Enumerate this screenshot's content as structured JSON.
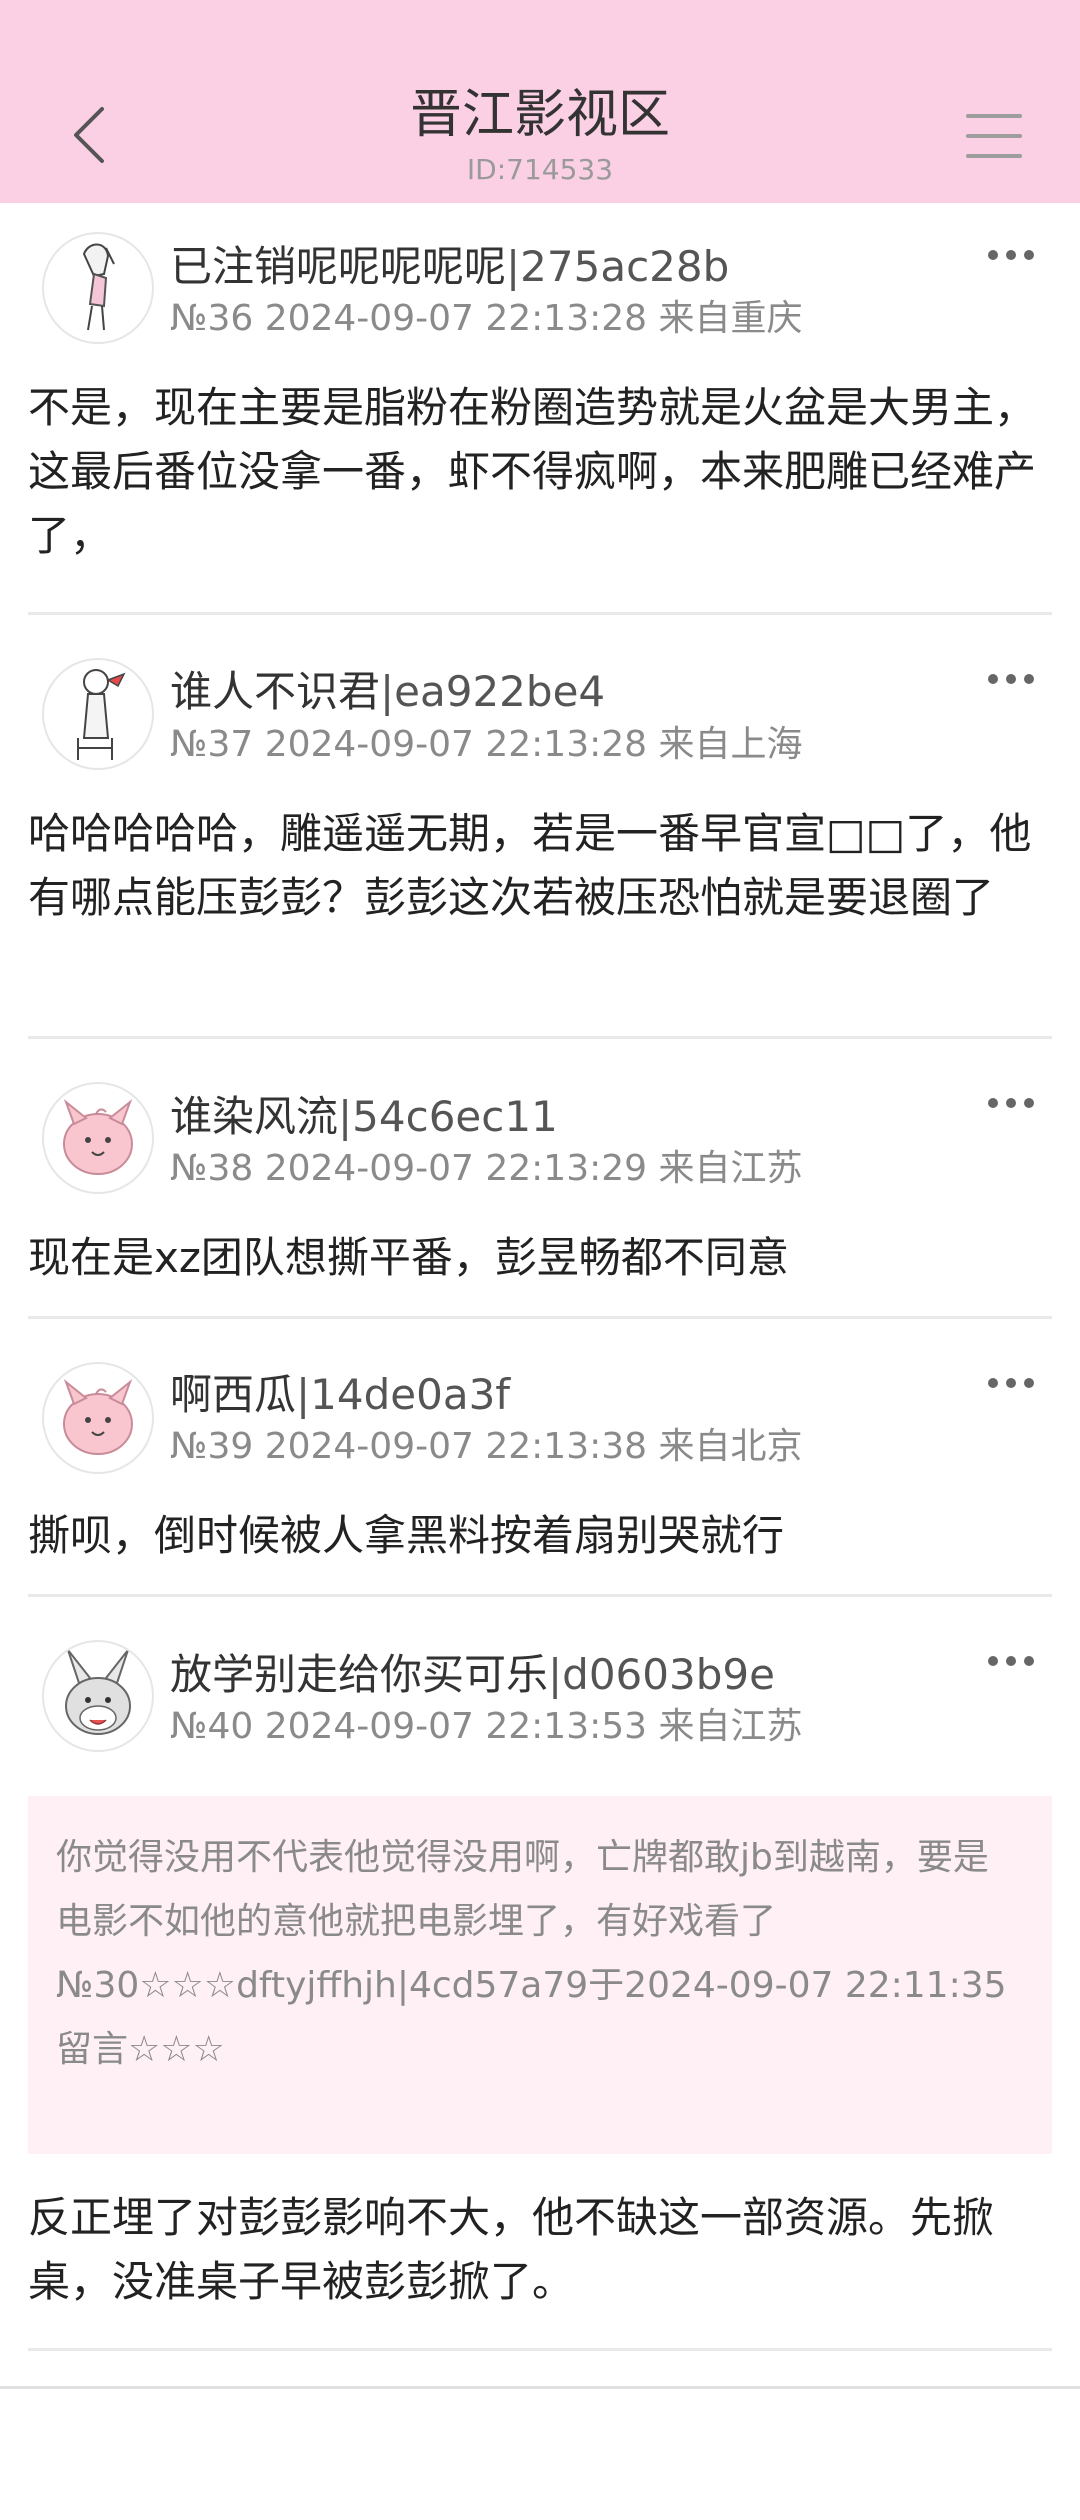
{
  "header": {
    "title": "晋江影视区",
    "subtitle": "ID:714533",
    "bg_color": "#fbd0e4"
  },
  "posts": [
    {
      "author": "已注销呢呢呢呢呢",
      "uid": "|275ac28b",
      "meta": "№36 2024-09-07 22:13:28 来自重庆",
      "content": "不是，现在主要是脂粉在粉圈造势就是火盆是大男主，这最后番位没拿一番，虾不得疯啊，本来肥雕已经难产了，",
      "avatar_icon": "anime-girl-avatar-icon"
    },
    {
      "author": "谁人不识君",
      "uid": "|ea922be4",
      "meta": "№37 2024-09-07 22:13:28 来自上海",
      "content": "哈哈哈哈哈，雕遥遥无期，若是一番早官宣□□了，他有哪点能压彭彭？彭彭这次若被压恐怕就是要退圈了",
      "avatar_icon": "sketch-girl-avatar-icon"
    },
    {
      "author": "谁染风流",
      "uid": "|54c6ec11",
      "meta": "№38 2024-09-07 22:13:29 来自江苏",
      "content": "现在是xz团队想撕平番，彭昱畅都不同意",
      "avatar_icon": "clefairy-avatar-icon"
    },
    {
      "author": "啊西瓜",
      "uid": "|14de0a3f",
      "meta": "№39 2024-09-07 22:13:38 来自北京",
      "content": "撕呗，倒时候被人拿黑料按着扇别哭就行",
      "avatar_icon": "clefairy-avatar-icon"
    },
    {
      "author": "放学别走给你买可乐",
      "uid": "|d0603b9e",
      "meta": "№40 2024-09-07 22:13:53 来自江苏",
      "quote_text": "你觉得没用不代表他觉得没用啊，亡牌都敢jb到越南，要是电影不如他的意他就把电影埋了，有好戏看了",
      "quote_ref": "№30☆☆☆dftyjffhjh|4cd57a79于2024-09-07 22:11:35留言☆☆☆",
      "content": "反正埋了对彭彭影响不大，他不缺这一部资源。先掀桌，没准桌子早被彭彭掀了。",
      "avatar_icon": "rabbit-avatar-icon"
    }
  ]
}
